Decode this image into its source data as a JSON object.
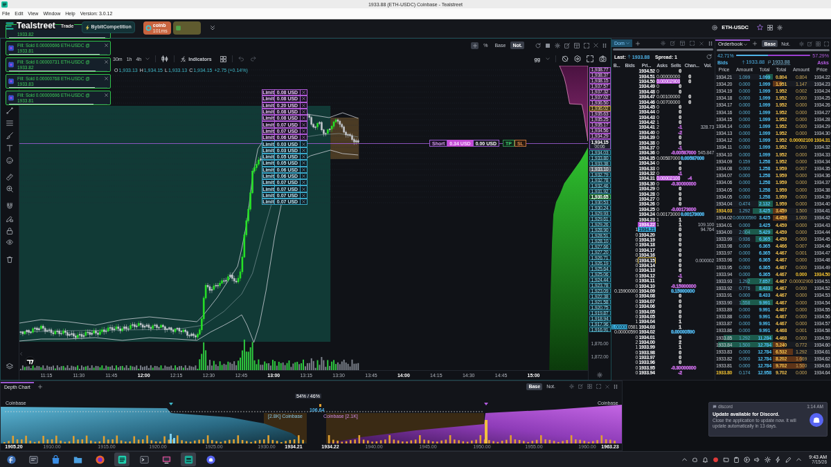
{
  "title_bar": {
    "title": "1933.88 (ETH-USDC) Coinbase - Tealstreet"
  },
  "menu": [
    "File",
    "Edit",
    "View",
    "Window",
    "Help",
    "Version: 3.0.12"
  ],
  "header": {
    "logo": "Tealstreet",
    "nav": [
      "Trade"
    ],
    "competition": "BybitCompetition",
    "exchanges": [
      {
        "name": "coinb",
        "latency": "101ms",
        "color": "#c8643f"
      },
      {
        "color": "#5f5b2f"
      }
    ],
    "symbol": "ETH-USDC"
  },
  "toasts": [
    {
      "price": "1933.82",
      "level": 0.98
    },
    {
      "title": "Fill: Sold 0.00000696 ETH-USDC @",
      "price": "1933.81",
      "level": 0.92
    },
    {
      "title": "Fill: Sold 0.00000731 ETH-USDC @",
      "price": "1933.82",
      "level": 0.88
    },
    {
      "title": "Fill: Sold 0.00000768 ETH-USDC @",
      "price": "1933.83",
      "level": 0.87
    },
    {
      "title": "Fill: Sold 0.00000696 ETH-USDC @",
      "price": "1933.81",
      "level": 0.86
    }
  ],
  "chart": {
    "scale_buttons": [
      {
        "label": "%",
        "selected": false
      },
      {
        "label": "Base",
        "selected": false
      },
      {
        "label": "Not.",
        "selected": true
      }
    ],
    "timeframes": [
      "30m",
      "1h",
      "4h"
    ],
    "indicators": "Indicators",
    "layout": "gg",
    "ohlc": [
      {
        "label": "O",
        "value": "1,933.13"
      },
      {
        "label": "H",
        "value": "1,934.15"
      },
      {
        "label": "L",
        "value": "1,933.13"
      },
      {
        "label": "C",
        "value": "1,934.15"
      }
    ],
    "change": "+2.75 (+0.14%)",
    "orders": [
      {
        "kind": "sell",
        "type": "Limit",
        "amount": "0.08 USD"
      },
      {
        "kind": "sell",
        "type": "Limit",
        "amount": "0.08 USD"
      },
      {
        "kind": "sell",
        "type": "Limit",
        "amount": "0.20 USD"
      },
      {
        "kind": "sell",
        "type": "Limit",
        "amount": "0.08 USD"
      },
      {
        "kind": "sell",
        "type": "Limit",
        "amount": "0.08 USD"
      },
      {
        "kind": "sell",
        "type": "Limit",
        "amount": "0.07 USD"
      },
      {
        "kind": "sell",
        "type": "Limit",
        "amount": "0.07 USD"
      },
      {
        "kind": "sell",
        "type": "Limit",
        "amount": "0.06 USD"
      },
      {
        "kind": "buy",
        "type": "Limit",
        "amount": "0.03 USD"
      },
      {
        "kind": "buy",
        "type": "Limit",
        "amount": "0.03 USD"
      },
      {
        "kind": "buy",
        "type": "Limit",
        "amount": "0.05 USD"
      },
      {
        "kind": "buy",
        "type": "Limit",
        "amount": "0.05 USD"
      },
      {
        "kind": "buy",
        "type": "Limit",
        "amount": "0.06 USD"
      },
      {
        "kind": "buy",
        "type": "Limit",
        "amount": "0.06 USD"
      },
      {
        "kind": "buy",
        "type": "Limit",
        "amount": "0.07 USD"
      },
      {
        "kind": "buy",
        "type": "Limit",
        "amount": "0.07 USD"
      },
      {
        "kind": "buy",
        "type": "Limit",
        "amount": "0.07 USD"
      },
      {
        "kind": "buy",
        "type": "Limit",
        "amount": "0.07 USD"
      }
    ],
    "position": {
      "side": "Short",
      "pnl": "0.34 USD",
      "size": "0.00 USD",
      "take_profit": "TP",
      "stop_loss": "SL"
    },
    "price_axis": [
      {
        "text": "1,938.77",
        "kind": "ask"
      },
      {
        "text": "1,938.37",
        "kind": "ask"
      },
      {
        "text": "1,938.15",
        "kind": "ask"
      },
      {
        "text": "1,937.57",
        "kind": "ask"
      },
      {
        "text": "1,937.32",
        "kind": "ask"
      },
      {
        "text": "1,937.02",
        "kind": "ask"
      },
      {
        "text": "1,936.50",
        "kind": "ask"
      },
      {
        "text": "1,936.02",
        "kind": "ask_mark"
      },
      {
        "text": "1,935.63",
        "kind": "ask"
      },
      {
        "text": "1,935.25",
        "kind": "ask"
      },
      {
        "text": "1,935.17",
        "kind": "ask"
      },
      {
        "text": "1,934.56",
        "kind": "ask"
      },
      {
        "text": "1,934.29",
        "kind": "ask"
      },
      {
        "text": "1,934.15",
        "kind": "current"
      },
      {
        "text": "1,934.03",
        "kind": "bid"
      },
      {
        "text": "1,933.80",
        "kind": "bid"
      },
      {
        "text": "1,933.38",
        "kind": "bid"
      },
      {
        "text": "1,933.10",
        "kind": "bid_mark"
      },
      {
        "text": "1,932.79",
        "kind": "bid"
      },
      {
        "text": "1,932.78",
        "kind": "bid"
      },
      {
        "text": "1,932.46",
        "kind": "bid"
      },
      {
        "text": "1,931.92",
        "kind": "bid"
      },
      {
        "text": "1,930.65",
        "kind": "bid_strong"
      },
      {
        "text": "1,930.53",
        "kind": "bid"
      },
      {
        "text": "1,930.24",
        "kind": "bid"
      },
      {
        "text": "1,929.93",
        "kind": "bid"
      },
      {
        "text": "1,929.61",
        "kind": "bid"
      },
      {
        "text": "1,929.26",
        "kind": "bid"
      },
      {
        "text": "1,928.90",
        "kind": "bid"
      },
      {
        "text": "1,928.51",
        "kind": "bid"
      },
      {
        "text": "1,928.10",
        "kind": "bid"
      },
      {
        "text": "1,927.66",
        "kind": "bid"
      },
      {
        "text": "1,927.20",
        "kind": "bid"
      },
      {
        "text": "1,926.71",
        "kind": "bid"
      },
      {
        "text": "1,926.19",
        "kind": "bid"
      },
      {
        "text": "1,925.64",
        "kind": "bid"
      },
      {
        "text": "1,925.06",
        "kind": "bid"
      },
      {
        "text": "1,924.44",
        "kind": "bid"
      },
      {
        "text": "1,923.78",
        "kind": "bid"
      },
      {
        "text": "1,923.09",
        "kind": "bid"
      },
      {
        "text": "1,922.38",
        "kind": "bid"
      },
      {
        "text": "1,921.58",
        "kind": "bid"
      },
      {
        "text": "1,920.75",
        "kind": "bid"
      },
      {
        "text": "1,919.87",
        "kind": "bid"
      },
      {
        "text": "1,918.94",
        "kind": "bid"
      },
      {
        "text": "1,917.96",
        "kind": "bid"
      },
      {
        "text": "1,916.91",
        "kind": "bid"
      },
      {
        "text": "1,876.00",
        "kind": "plain"
      },
      {
        "text": "1,872.00",
        "kind": "plain"
      }
    ],
    "countdown": "00:06",
    "time_axis": [
      {
        "label": "11:15",
        "major": false
      },
      {
        "label": "11:30",
        "major": false
      },
      {
        "label": "11:45",
        "major": false
      },
      {
        "label": "12:00",
        "major": true
      },
      {
        "label": "12:15",
        "major": false
      },
      {
        "label": "12:30",
        "major": false
      },
      {
        "label": "12:45",
        "major": false
      },
      {
        "label": "13:00",
        "major": true
      },
      {
        "label": "13:15",
        "major": false
      },
      {
        "label": "13:30",
        "major": false
      },
      {
        "label": "13:45",
        "major": false
      },
      {
        "label": "14:00",
        "major": true
      },
      {
        "label": "14:15",
        "major": false
      },
      {
        "label": "14:30",
        "major": false
      },
      {
        "label": "14:45",
        "major": false
      },
      {
        "label": "15:00",
        "major": true
      }
    ]
  },
  "dom": {
    "tab": "Dom",
    "last_label": "Last:",
    "last": "1933.88",
    "spread": "Spread: 1",
    "columns": [
      "B...",
      "Bids",
      "Pri...",
      "Asks",
      "Sells",
      "Chan...",
      "Vol."
    ],
    "rows": [
      {
        "kind": "plain",
        "price": "1934.52",
        "asks": "0",
        "change": {
          "value": "0"
        }
      },
      {
        "kind": "plain",
        "price": "1934.51",
        "asks": "0.00000000",
        "change": {
          "value": "0"
        }
      },
      {
        "kind": "own",
        "price": "1934.50",
        "asks": "0.00002900",
        "change": {
          "value": "0"
        }
      },
      {
        "kind": "plain",
        "price": "1934.49",
        "asks": "0",
        "change": {
          "value": "0"
        }
      },
      {
        "kind": "plain",
        "price": "1934.48",
        "asks": "0",
        "change": {
          "value": "0"
        }
      },
      {
        "kind": "plain",
        "price": "1934.47",
        "asks": "0.00100000",
        "change": {
          "value": "0"
        }
      },
      {
        "kind": "plain",
        "price": "1934.46",
        "asks": "0.00700000",
        "change": {
          "value": "0"
        }
      },
      {
        "kind": "plain",
        "price": "1934.45",
        "asks": "0",
        "change": {
          "value": "0"
        }
      },
      {
        "kind": "plain",
        "price": "1934.44",
        "asks": "0",
        "change": {
          "value": "0"
        }
      },
      {
        "kind": "plain",
        "price": "1934.43",
        "asks": "0",
        "change": {
          "value": "0"
        }
      },
      {
        "kind": "plain",
        "price": "1934.42",
        "asks": "1",
        "change": {
          "value": "0"
        }
      },
      {
        "kind": "plain",
        "price": "1934.41",
        "asks": "2",
        "change": {
          "value": "-1",
          "color": "#c46be0"
        },
        "volume": "328.73"
      },
      {
        "kind": "plain",
        "price": "1934.40",
        "asks": "0",
        "change": {
          "value": "-2",
          "color": "#c46be0"
        }
      },
      {
        "kind": "plain",
        "price": "1934.39",
        "asks": "0",
        "change": {
          "value": "0"
        }
      },
      {
        "kind": "plain",
        "price": "1934.38",
        "asks": "0",
        "change": {
          "value": "0"
        }
      },
      {
        "kind": "plain",
        "price": "1934.37",
        "asks": "0",
        "change": {
          "value": "-1",
          "color": "#c46be0"
        }
      },
      {
        "kind": "plain",
        "price": "1934.36",
        "asks": "0",
        "change": {
          "value": "-0.00587000",
          "color": "#c46be0"
        },
        "volume": "545.847"
      },
      {
        "kind": "plain",
        "price": "1934.35",
        "asks": "0.00587000",
        "change": {
          "value": "0.00587000",
          "color": "#4fb3e8"
        }
      },
      {
        "kind": "plain",
        "price": "1934.34",
        "asks": "0",
        "change": {
          "value": "0"
        }
      },
      {
        "kind": "plain",
        "price": "1934.33",
        "asks": "0",
        "change": {
          "value": "0"
        }
      },
      {
        "kind": "plain",
        "price": "1934.32",
        "asks": "0",
        "change": {
          "value": "-1",
          "color": "#c46be0"
        }
      },
      {
        "kind": "own",
        "price": "1934.31",
        "asks": "0.00002100",
        "change": {
          "value": "-4",
          "color": "#c46be0"
        }
      },
      {
        "kind": "plain",
        "price": "1934.30",
        "asks": "0",
        "change": {
          "value": "-0.30000000",
          "color": "#c46be0"
        }
      },
      {
        "kind": "plain",
        "price": "1934.29",
        "asks": "0",
        "change": {
          "value": "0"
        }
      },
      {
        "kind": "plain",
        "price": "1934.28",
        "asks": "0",
        "change": {
          "value": "0"
        }
      },
      {
        "kind": "plain",
        "price": "1934.27",
        "asks": "0",
        "change": {
          "value": "0"
        }
      },
      {
        "kind": "plain",
        "price": "1934.26",
        "asks": "0",
        "change": {
          "value": "0"
        }
      },
      {
        "kind": "plain",
        "price": "1934.25",
        "asks": "0",
        "change": {
          "value": "-0.00173000",
          "color": "#c46be0"
        }
      },
      {
        "kind": "plain",
        "price": "1934.24",
        "asks": "0.00173000",
        "change": {
          "value": "0.00173000",
          "color": "#4fb3e8"
        }
      },
      {
        "kind": "plain",
        "price": "1934.23",
        "asks": "1",
        "change": {
          "value": "1"
        }
      },
      {
        "kind": "ask",
        "price": "1934.22",
        "asks": "1",
        "change": {
          "value": "1"
        },
        "volume": "109.100"
      },
      {
        "kind": "bid",
        "price": "1934.21",
        "bids": "1",
        "change": {
          "value": "0"
        },
        "volume": "94.764"
      },
      {
        "kind": "plain",
        "price": "1934.20",
        "bids": "0",
        "change": {
          "value": "0"
        }
      },
      {
        "kind": "plain",
        "price": "1934.19",
        "bids": "0",
        "change": {
          "value": "0"
        }
      },
      {
        "kind": "plain",
        "price": "1934.18",
        "bids": "0",
        "change": {
          "value": "0"
        }
      },
      {
        "kind": "plain",
        "price": "1934.17",
        "bids": "0",
        "change": {
          "value": "0"
        }
      },
      {
        "kind": "plain",
        "price": "1934.16",
        "bids": "0",
        "change": {
          "value": "0"
        }
      },
      {
        "kind": "outline",
        "price": "1934.15",
        "bids": "0",
        "change": {
          "value": "0"
        },
        "volume": "0.000002"
      },
      {
        "kind": "plain",
        "price": "1934.14",
        "bids": "0",
        "change": {
          "value": "0"
        }
      },
      {
        "kind": "plain",
        "price": "1934.13",
        "bids": "0",
        "change": {
          "value": "0"
        }
      },
      {
        "kind": "plain",
        "price": "1934.12",
        "bids": "0",
        "change": {
          "value": "-1",
          "color": "#c46be0"
        }
      },
      {
        "kind": "plain",
        "price": "1934.11",
        "bids": "0",
        "change": {
          "value": "0"
        }
      },
      {
        "kind": "plain",
        "price": "1934.10",
        "bids": "0",
        "change": {
          "value": "-0.15900000",
          "color": "#c46be0"
        }
      },
      {
        "kind": "plain",
        "price": "1934.09",
        "bids": "0.15900000",
        "change": {
          "value": "0.15900000",
          "color": "#4fb3e8"
        }
      },
      {
        "kind": "plain",
        "price": "1934.08",
        "bids": "0",
        "change": {
          "value": "0"
        }
      },
      {
        "kind": "plain",
        "price": "1934.07",
        "bids": "0",
        "change": {
          "value": "0"
        }
      },
      {
        "kind": "plain",
        "price": "1934.06",
        "bids": "0",
        "change": {
          "value": "0"
        }
      },
      {
        "kind": "plain",
        "price": "1934.05",
        "bids": "0",
        "change": {
          "value": "0"
        }
      },
      {
        "kind": "plain",
        "price": "1934.05",
        "bids": "0",
        "change": {
          "value": "0"
        }
      },
      {
        "kind": "plain",
        "price": "1934.04",
        "bids": "1",
        "change": {
          "value": "1"
        }
      },
      {
        "kind": "plain",
        "price": "1934.03",
        "column_1": "1.00000",
        "bids": "0581",
        "change": {
          "value": "1"
        }
      },
      {
        "kind": "plain",
        "price": "1934.02",
        "bids": "0.00000590",
        "change": {
          "value": "0.00000590",
          "color": "#4fb3e8"
        }
      },
      {
        "kind": "plain",
        "price": "1934.01",
        "bids": "0",
        "change": {
          "value": "0"
        }
      },
      {
        "kind": "plain",
        "price": "1934.00",
        "bids": "2",
        "change": {
          "value": "2"
        }
      },
      {
        "kind": "plain",
        "price": "1933.99",
        "bids": "1",
        "change": {
          "value": "1"
        }
      },
      {
        "kind": "plain",
        "price": "1933.98",
        "bids": "0",
        "change": {
          "value": "0"
        }
      },
      {
        "kind": "plain",
        "price": "1933.97",
        "bids": "0",
        "change": {
          "value": "0"
        }
      },
      {
        "kind": "plain",
        "price": "1933.96",
        "bids": "0",
        "change": {
          "value": "0"
        }
      },
      {
        "kind": "plain",
        "price": "1933.95",
        "bids": "0",
        "change": {
          "value": "-0.30000000",
          "color": "#c46be0"
        }
      },
      {
        "kind": "plain",
        "price": "1933.94",
        "bids": "0",
        "change": {
          "value": "-2",
          "color": "#c46be0"
        }
      }
    ]
  },
  "orderbook": {
    "tab": "Orderbook",
    "modes": [
      {
        "label": "Base",
        "selected": true
      },
      {
        "label": "Not.",
        "selected": false
      }
    ],
    "ratio": {
      "bids": "42.71%",
      "asks": "57.29%",
      "level": 0.4271
    },
    "bids_label": "Bids",
    "last": "1933.88",
    "mark_price": "1933.88",
    "asks_label": "Asks",
    "columns": [
      "Price",
      "Amount",
      "Total",
      "Total",
      "Amount",
      "Price"
    ],
    "rows": [
      {
        "bid": {
          "price": "1934.21",
          "amount": "1.099",
          "total": "1.099",
          "own_order": false,
          "level": 0.12
        },
        "ask": {
          "total": "0.804",
          "amount": "0.804",
          "price": "1934.22",
          "own_order": false
        }
      },
      {
        "bid": {
          "price": "1934.20",
          "amount": "0.000",
          "total": "1.099",
          "own_order": false
        },
        "ask": {
          "total": "1.951",
          "amount": "1.147",
          "price": "1934.23",
          "own_order": false,
          "level": 0.15
        }
      },
      {
        "bid": {
          "price": "1934.19",
          "amount": "0.000",
          "total": "1.099",
          "own_order": false
        },
        "ask": {
          "total": "1.952",
          "amount": "0.002",
          "price": "1934.24",
          "own_order": false
        }
      },
      {
        "bid": {
          "price": "1934.18",
          "amount": "0.000",
          "total": "1.099",
          "own_order": false
        },
        "ask": {
          "total": "1.952",
          "amount": "0.000",
          "price": "1934.25",
          "own_order": false
        }
      },
      {
        "bid": {
          "price": "1934.17",
          "amount": "0.000",
          "total": "1.099",
          "own_order": false
        },
        "ask": {
          "total": "1.952",
          "amount": "0.000",
          "price": "1934.26",
          "own_order": false
        }
      },
      {
        "bid": {
          "price": "1934.16",
          "amount": "0.000",
          "total": "1.099",
          "own_order": false
        },
        "ask": {
          "total": "1.952",
          "amount": "0.000",
          "price": "1934.27",
          "own_order": false
        }
      },
      {
        "bid": {
          "price": "1934.15",
          "amount": "0.000",
          "total": "1.099",
          "own_order": false
        },
        "ask": {
          "total": "1.952",
          "amount": "0.000",
          "price": "1934.28",
          "own_order": false
        }
      },
      {
        "bid": {
          "price": "1934.14",
          "amount": "0.000",
          "total": "1.099",
          "own_order": false
        },
        "ask": {
          "total": "1.952",
          "amount": "0.000",
          "price": "1934.29",
          "own_order": false
        }
      },
      {
        "bid": {
          "price": "1934.13",
          "amount": "0.000",
          "total": "1.099",
          "own_order": false
        },
        "ask": {
          "total": "1.952",
          "amount": "0.000",
          "price": "1934.30",
          "own_order": false
        }
      },
      {
        "bid": {
          "price": "1934.12",
          "amount": "0.000",
          "total": "1.099",
          "own_order": false
        },
        "ask": {
          "total": "1.952",
          "amount": "0.00002100",
          "price": "1934.31",
          "own_order": true
        }
      },
      {
        "bid": {
          "price": "1934.11",
          "amount": "0.000",
          "total": "1.099",
          "own_order": false
        },
        "ask": {
          "total": "1.952",
          "amount": "0.000",
          "price": "1934.32",
          "own_order": false
        }
      },
      {
        "bid": {
          "price": "1934.10",
          "amount": "0.000",
          "total": "1.099",
          "own_order": false
        },
        "ask": {
          "total": "1.952",
          "amount": "0.000",
          "price": "1934.33",
          "own_order": false
        }
      },
      {
        "bid": {
          "price": "1934.09",
          "amount": "0.159",
          "total": "1.258",
          "own_order": false
        },
        "ask": {
          "total": "1.952",
          "amount": "0.000",
          "price": "1934.34",
          "own_order": false
        }
      },
      {
        "bid": {
          "price": "1934.08",
          "amount": "0.000",
          "total": "1.258",
          "own_order": false
        },
        "ask": {
          "total": "1.959",
          "amount": "0.007",
          "price": "1934.35",
          "own_order": false
        }
      },
      {
        "bid": {
          "price": "1934.07",
          "amount": "0.000",
          "total": "1.258",
          "own_order": false
        },
        "ask": {
          "total": "1.959",
          "amount": "0.000",
          "price": "1934.36",
          "own_order": false
        }
      },
      {
        "bid": {
          "price": "1934.06",
          "amount": "0.000",
          "total": "1.258",
          "own_order": false
        },
        "ask": {
          "total": "1.959",
          "amount": "0.000",
          "price": "1934.37",
          "own_order": false
        }
      },
      {
        "bid": {
          "price": "1934.05",
          "amount": "0.000",
          "total": "1.258",
          "own_order": false
        },
        "ask": {
          "total": "1.959",
          "amount": "0.000",
          "price": "1934.38",
          "own_order": false
        }
      },
      {
        "bid": {
          "price": "1934.05",
          "amount": "0.000",
          "total": "1.258",
          "own_order": false
        },
        "ask": {
          "total": "1.959",
          "amount": "0.000",
          "price": "1934.39",
          "own_order": false
        }
      },
      {
        "bid": {
          "price": "1934.04",
          "amount": "0.474",
          "total": "2.132",
          "own_order": false,
          "level": 0.25
        },
        "ask": {
          "total": "1.959",
          "amount": "0.000",
          "price": "1934.40",
          "own_order": false
        }
      },
      {
        "bid": {
          "price": "1934.03",
          "amount": "1.292",
          "total": "3.425",
          "own_order": true,
          "level": 0.35
        },
        "ask": {
          "total": "3.459",
          "amount": "1.500",
          "price": "1934.41",
          "own_order": false,
          "level": 0.2
        }
      },
      {
        "bid": {
          "price": "1934.02",
          "amount": "0.00000590",
          "total": "3.425",
          "own_order": false
        },
        "ask": {
          "total": "4.459",
          "amount": "1.000",
          "price": "1934.42",
          "own_order": false,
          "level": 0.25
        }
      },
      {
        "bid": {
          "price": "1934.01",
          "amount": "0.000",
          "total": "3.425",
          "own_order": false
        },
        "ask": {
          "total": "4.459",
          "amount": "0.000",
          "price": "1934.43",
          "own_order": false
        }
      },
      {
        "bid": {
          "price": "1934.00",
          "amount": "2.004",
          "total": "5.429",
          "own_order": false,
          "level": 0.5
        },
        "ask": {
          "total": "4.459",
          "amount": "0.000",
          "price": "1934.44",
          "own_order": false
        }
      },
      {
        "bid": {
          "price": "1933.99",
          "amount": "0.936",
          "total": "6.365",
          "own_order": false,
          "level": 0.3
        },
        "ask": {
          "total": "4.459",
          "amount": "0.000",
          "price": "1934.45",
          "own_order": false
        }
      },
      {
        "bid": {
          "price": "1933.98",
          "amount": "0.000",
          "total": "6.365",
          "own_order": false
        },
        "ask": {
          "total": "4.466",
          "amount": "0.007",
          "price": "1934.46",
          "own_order": false
        }
      },
      {
        "bid": {
          "price": "1933.97",
          "amount": "0.000",
          "total": "6.365",
          "own_order": false
        },
        "ask": {
          "total": "4.467",
          "amount": "0.001",
          "price": "1934.47",
          "own_order": false
        }
      },
      {
        "bid": {
          "price": "1933.96",
          "amount": "0.000",
          "total": "6.365",
          "own_order": false
        },
        "ask": {
          "total": "4.467",
          "amount": "0.000",
          "price": "1934.48",
          "own_order": false
        }
      },
      {
        "bid": {
          "price": "1933.95",
          "amount": "0.000",
          "total": "6.365",
          "own_order": false
        },
        "ask": {
          "total": "4.467",
          "amount": "0.000",
          "price": "1934.49",
          "own_order": false
        }
      },
      {
        "bid": {
          "price": "1933.94",
          "amount": "0.000",
          "total": "6.365",
          "own_order": false
        },
        "ask": {
          "total": "4.467",
          "amount": "0.000",
          "price": "1934.50",
          "own_order": true
        }
      },
      {
        "bid": {
          "price": "1933.93",
          "amount": "1.292",
          "total": "7.657",
          "own_order": false,
          "level": 0.45
        },
        "ask": {
          "total": "4.467",
          "amount": "0.00002900",
          "price": "1934.51",
          "own_order": false
        }
      },
      {
        "bid": {
          "price": "1933.92",
          "amount": "0.776",
          "total": "8.433",
          "own_order": false,
          "level": 0.3
        },
        "ask": {
          "total": "4.467",
          "amount": "0.000",
          "price": "1934.52",
          "own_order": false
        }
      },
      {
        "bid": {
          "price": "1933.91",
          "amount": "0.000",
          "total": "8.433",
          "own_order": false
        },
        "ask": {
          "total": "4.467",
          "amount": "0.000",
          "price": "1934.53",
          "own_order": false
        }
      },
      {
        "bid": {
          "price": "1933.90",
          "amount": "1.558",
          "total": "9.991",
          "own_order": false,
          "level": 0.55
        },
        "ask": {
          "total": "4.467",
          "amount": "0.000",
          "price": "1934.54",
          "own_order": false
        }
      },
      {
        "bid": {
          "price": "1933.89",
          "amount": "0.000",
          "total": "9.991",
          "own_order": false
        },
        "ask": {
          "total": "4.467",
          "amount": "0.000",
          "price": "1934.55",
          "own_order": false
        }
      },
      {
        "bid": {
          "price": "1933.88",
          "amount": "0.000",
          "total": "9.991",
          "own_order": false
        },
        "ask": {
          "total": "4.467",
          "amount": "0.000",
          "price": "1934.56",
          "own_order": false
        }
      },
      {
        "bid": {
          "price": "1933.87",
          "amount": "0.000",
          "total": "9.991",
          "own_order": false
        },
        "ask": {
          "total": "4.467",
          "amount": "0.000",
          "price": "1934.57",
          "own_order": false
        }
      },
      {
        "bid": {
          "price": "1933.86",
          "amount": "0.000",
          "total": "9.991",
          "own_order": false
        },
        "ask": {
          "total": "4.468",
          "amount": "0.001",
          "price": "1934.58",
          "own_order": false
        }
      },
      {
        "bid": {
          "price": "1933.85",
          "amount": "1.292",
          "total": "11.284",
          "own_order": false,
          "level": 0.85
        },
        "ask": {
          "total": "4.468",
          "amount": "0.000",
          "price": "1934.59",
          "own_order": false
        }
      },
      {
        "bid": {
          "price": "1933.84",
          "amount": "1.500",
          "total": "12.784",
          "own_order": false,
          "level": 0.95
        },
        "ask": {
          "total": "5.240",
          "amount": "0.772",
          "price": "1934.60",
          "own_order": false,
          "level": 0.2
        }
      },
      {
        "bid": {
          "price": "1933.83",
          "amount": "0.000",
          "total": "12.784",
          "own_order": false
        },
        "ask": {
          "total": "6.532",
          "amount": "1.292",
          "price": "1934.61",
          "own_order": false,
          "level": 0.35
        }
      },
      {
        "bid": {
          "price": "1933.82",
          "amount": "0.000",
          "total": "12.784",
          "own_order": false
        },
        "ask": {
          "total": "8.202",
          "amount": "1.669",
          "price": "1934.62",
          "own_order": false,
          "level": 0.5
        }
      },
      {
        "bid": {
          "price": "1933.81",
          "amount": "0.000",
          "total": "12.784",
          "own_order": false
        },
        "ask": {
          "total": "9.702",
          "amount": "1.500",
          "price": "1934.63",
          "own_order": false,
          "level": 0.55
        }
      },
      {
        "bid": {
          "price": "1933.80",
          "amount": "0.174",
          "total": "12.958",
          "own_order": true
        },
        "ask": {
          "total": "9.702",
          "amount": "0.000",
          "price": "1934.64",
          "own_order": false
        }
      }
    ]
  },
  "depth_chart": {
    "tab": "Depth Chart",
    "modes": [
      {
        "label": "Base",
        "selected": true
      },
      {
        "label": "Not.",
        "selected": false
      }
    ],
    "labels": [
      "Coinbase",
      "54% / 46%",
      "106.64",
      "[2.8K] Coinbase",
      "Coinbase [2.1K]",
      "Coinbase"
    ],
    "x_axis": [
      {
        "label": "1905.20",
        "major": true
      },
      {
        "label": "1910.00",
        "major": false
      },
      {
        "label": "1915.00",
        "major": false
      },
      {
        "label": "1920.00",
        "major": false
      },
      {
        "label": "1925.00",
        "major": false
      },
      {
        "label": "1930.00",
        "major": false
      },
      {
        "label": "1934.21",
        "major": true
      },
      {
        "label": "1934.22",
        "major": true
      },
      {
        "label": "1940.00",
        "major": false
      },
      {
        "label": "1945.00",
        "major": false
      },
      {
        "label": "1950.00",
        "major": false
      },
      {
        "label": "1955.00",
        "major": false
      },
      {
        "label": "1960.00",
        "major": false
      },
      {
        "label": "1963.23",
        "major": true
      }
    ]
  },
  "notification": {
    "app": "discord",
    "time": "1:14 AM",
    "title": "Update available for Discord.",
    "body": "Close the application to update now. It will update automatically in 13 days."
  },
  "taskbar": {
    "apps": [
      {
        "selected": false
      },
      {
        "selected": false
      },
      {
        "selected": false
      },
      {
        "selected": false
      },
      {
        "selected": false
      },
      {
        "selected": true
      },
      {
        "selected": false
      },
      {
        "selected": false
      },
      {
        "selected": true
      },
      {
        "selected": false
      }
    ],
    "time": "9:43 AM",
    "date": "7/15/26"
  }
}
